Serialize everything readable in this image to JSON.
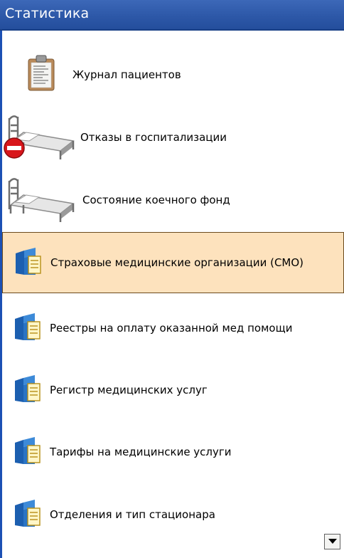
{
  "header": {
    "title": "Статистика"
  },
  "items": [
    {
      "label": "Журнал пациентов",
      "icon": "clipboard-icon"
    },
    {
      "label": "Отказы в госпитализации",
      "icon": "bed-denied-icon"
    },
    {
      "label": "Состояние коечного фонд",
      "icon": "bed-icon"
    },
    {
      "label": "Страховые медицинские организации (СМО)",
      "icon": "folder-document-icon",
      "selected": true
    },
    {
      "label": "Реестры на оплату оказанной мед помощи",
      "icon": "folder-document-icon"
    },
    {
      "label": "Регистр медицинских услуг",
      "icon": "folder-document-icon"
    },
    {
      "label": "Тарифы на медицинские услуги",
      "icon": "folder-document-icon"
    },
    {
      "label": "Отделения и тип стационара",
      "icon": "folder-document-icon"
    }
  ],
  "colors": {
    "header": "#2d58a8",
    "selected_bg": "#fde2bd",
    "left_border": "#1c50b4"
  },
  "scroll": {
    "icon": "chevron-down-icon"
  }
}
